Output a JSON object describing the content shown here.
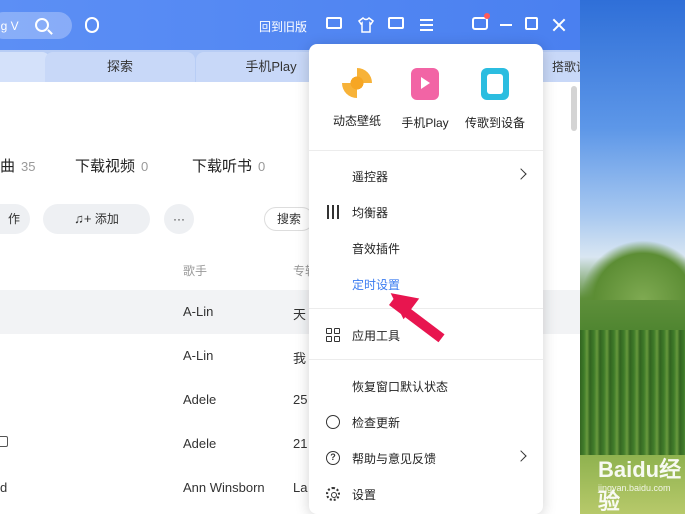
{
  "titlebar": {
    "search_text": "ng V",
    "back_to_old": "回到旧版"
  },
  "tabs": [
    "",
    "探索",
    "手机Play",
    "搭歌词"
  ],
  "counts": [
    {
      "label": "曲",
      "n": "35"
    },
    {
      "label": "下载视频",
      "n": "0"
    },
    {
      "label": "下载听书",
      "n": "0"
    }
  ],
  "actions": {
    "left": "作",
    "add": "添加",
    "more": "···",
    "search": "搜索"
  },
  "columns": {
    "artist": "歌手",
    "album": "专辑"
  },
  "rows": [
    {
      "artist": "A-Lin",
      "album": "天",
      "suffix": ""
    },
    {
      "artist": "A-Lin",
      "album": "我",
      "suffix": ""
    },
    {
      "artist": "Adele",
      "album": "25",
      "suffix": ""
    },
    {
      "artist": "Adele",
      "album": "21",
      "suffix": ""
    },
    {
      "artist": "Ann Winsborn",
      "album": "La",
      "suffix": "d"
    }
  ],
  "menu": {
    "features": [
      {
        "label": "动态壁纸",
        "icon": "wallpaper-fan-icon"
      },
      {
        "label": "手机Play",
        "icon": "phone-play-icon"
      },
      {
        "label": "传歌到设备",
        "icon": "transfer-device-icon"
      }
    ],
    "items": [
      {
        "label": "遥控器",
        "has_sub": true
      },
      {
        "label": "均衡器"
      },
      {
        "label": "音效插件"
      },
      {
        "label": "定时设置",
        "active": true
      },
      {
        "label": "应用工具"
      },
      {
        "label": "恢复窗口默认状态"
      },
      {
        "label": "检查更新"
      },
      {
        "label": "帮助与意见反馈",
        "has_sub": true
      },
      {
        "label": "设置"
      }
    ]
  },
  "watermark": {
    "brand": "Baidu经验",
    "url": "jingyan.baidu.com"
  },
  "colors": {
    "accent": "#3b7cf0",
    "titlebar": "#4a80f0",
    "pointer": "#e8154f"
  }
}
